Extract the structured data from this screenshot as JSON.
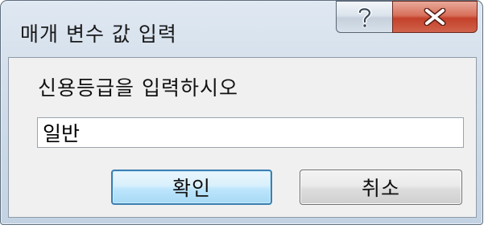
{
  "window": {
    "title": "매개 변수 값 입력",
    "help_icon": "question-mark-icon",
    "close_icon": "close-x-icon"
  },
  "form": {
    "prompt": "신용등급을 입력하시오",
    "input_value": "일반"
  },
  "buttons": {
    "ok_label": "확인",
    "cancel_label": "취소"
  },
  "colors": {
    "close_button": "#c4412a",
    "ok_button_border": "#3c7fb1",
    "dialog_frame": "#c4d3e3"
  }
}
